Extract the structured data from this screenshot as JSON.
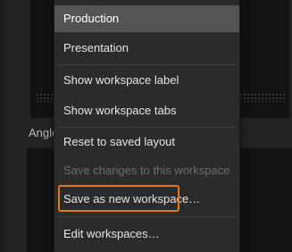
{
  "background": {
    "panel_label": "Angle"
  },
  "menu": {
    "items": [
      {
        "label": "Production",
        "state": "selected"
      },
      {
        "label": "Presentation",
        "state": "normal"
      },
      {
        "label": "Show workspace label",
        "state": "normal"
      },
      {
        "label": "Show workspace tabs",
        "state": "normal"
      },
      {
        "label": "Reset to saved layout",
        "state": "normal"
      },
      {
        "label": "Save changes to this workspace",
        "state": "disabled"
      },
      {
        "label": "Save as new workspace…",
        "state": "highlighted"
      },
      {
        "label": "Edit workspaces…",
        "state": "normal"
      }
    ]
  },
  "colors": {
    "highlight_outline": "#e07a16",
    "selected_background": "#545454",
    "menu_background": "#2b2b2b"
  }
}
